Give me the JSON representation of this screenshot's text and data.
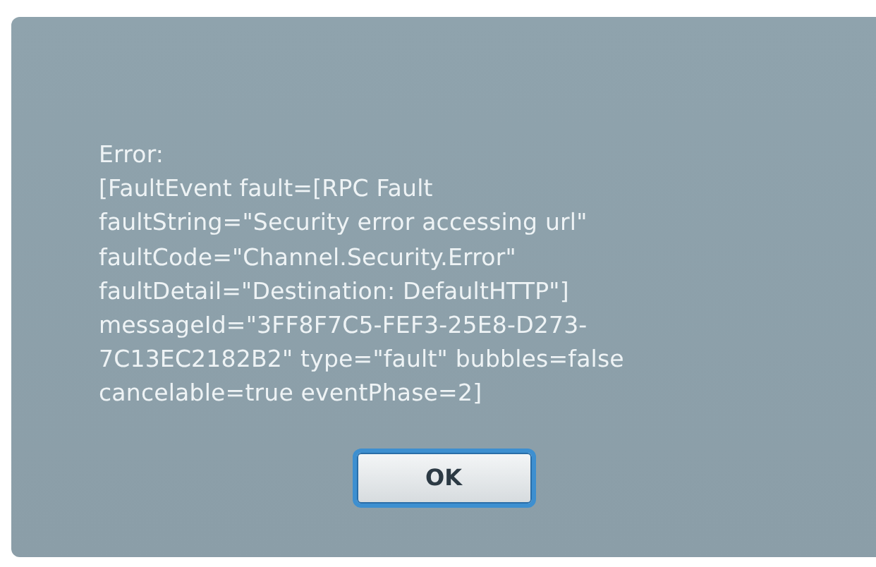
{
  "dialog": {
    "message_lines": [
      "Error:",
      "[FaultEvent fault=[RPC Fault",
      "faultString=\"Security error accessing url\"",
      "faultCode=\"Channel.Security.Error\"",
      "faultDetail=\"Destination: DefaultHTTP\"]",
      "messageId=\"3FF8F7C5-FEF3-25E8-D273-",
      "7C13EC2182B2\" type=\"fault\" bubbles=false",
      "cancelable=true eventPhase=2]"
    ],
    "buttons": [
      {
        "label": "OK"
      }
    ]
  }
}
